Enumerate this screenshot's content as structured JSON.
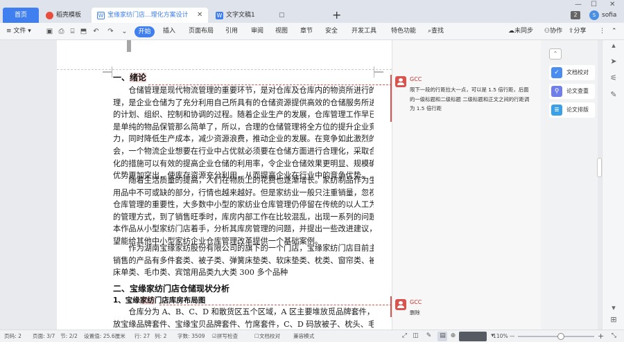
{
  "tabs": {
    "home": "首页",
    "template": "稻壳模板",
    "doc": "宝缘家纺门店...理化方案设计",
    "doc2": "文字文稿1",
    "add": "+"
  },
  "window": {
    "min": "—",
    "max": "☐",
    "close": "✕",
    "badge": "2",
    "user": "sofia"
  },
  "ribbon": {
    "file": "≡ 文件 ▾",
    "start": "开始",
    "tabs": [
      "插入",
      "页面布局",
      "引用",
      "审阅",
      "视图",
      "章节",
      "安全",
      "开发工具",
      "特色功能"
    ],
    "search": "查找",
    "sync": "未同步",
    "collab": "协作",
    "share": "分享"
  },
  "document": {
    "h1_num": "一、",
    "h1_text": "绪论",
    "p1": [
      "　　仓储管理是现代物流管理的重要环节，是对仓库及仓库内的物资所进行的管",
      "理，是企业仓储为了充分利用自己所具有的仓储资源提供高效的仓储服务所进行",
      "的计划、组织、控制和协调的过程。随着企业生产的发展，仓库管理工作早已不",
      "是单纯的物品保管那么简单了，所以，合理的仓储管理将全方位的提升企业竞争",
      "力，同时降低生产成本，减少资源浪费，推动企业的发展。在竞争如此激烈的社",
      "会，一个物流企业想要在行业中占优就必须要在仓储方面进行合理化，采取合理",
      "化的措施可以有效的提高企业仓储的利用率，令企业仓储效果更明显、规模确定、",
      "优势更加突出，使库存资源充分利用，从而提高企业在行业中的竞争优势。"
    ],
    "p2": [
      "　　随着生活质量的提高，人们在物质上的花费也逐渐增长。家纺制品作为生活",
      "用品中不可或缺的部分，行情也越来越好。但是家纺业一般只注重销量，忽视了",
      "仓库管理的重要性，大多数中小型的家纺业仓库管理仍停留在传统的以人工为主",
      "的管理方式，到了销售旺季时，库房内部工作在比较混乱，出现一系列的问题。",
      "本作品从小型家纺门店着手，分析其库房管理的问题，并提出一些改进建议，希",
      "望能给其他中小型家纺企业仓库管理改革提供一个基础案例。"
    ],
    "p3": [
      "　　作为湖南宝缘家纺股份有限公司的旗下的一个门店，宝缘家纺门店目前主要",
      "销售的产品有多件套类、被子类、弹簧床垫类、软床垫类、枕类、窗帘类、被套",
      "床单类、毛巾类、宾馆用品类九大类 300 多个品种"
    ],
    "h2_text": "二、宝缘家纺门店仓储现状分析",
    "h3_pre": "1、宝缘",
    "h3_hl": "家纺",
    "h3_post": "门店库房布局图",
    "p4": [
      "　　仓库分为 A、B、C、D 和散货区五个区域，A 区主要堆放觅品牌套件，B 区码",
      "放宝缘品牌套件、宝缘宝贝品牌套件、竹席套件，C、D 码放被子、枕头、毛毯。"
    ]
  },
  "comments": [
    {
      "author": "GCC",
      "text": "限下一段的行距拉大一点，可以是 1.5 倍行距，后面的一级标题和二级标题 二级标题和正文之间的行距调为 1.5 倍行距"
    },
    {
      "author": "GCC",
      "text": "删除"
    }
  ],
  "right_panel": {
    "collapse": "⌃",
    "buttons": [
      {
        "label": "文档校对",
        "color": "#4a8df0"
      },
      {
        "label": "论文查重",
        "color": "#6f7ee8"
      },
      {
        "label": "论文排版",
        "color": "#3aa0e8"
      }
    ]
  },
  "status": {
    "page_num": "页码: 2",
    "page": "页面: 3/7",
    "section": "节: 2/2",
    "setting": "设置值: 25.6厘米",
    "row": "行: 27",
    "col": "列: 2",
    "words": "字数: 3509",
    "spell": "拼写检查",
    "proof": "文档校对",
    "compat": "兼容模式",
    "zoom": "110%",
    "minus": "—",
    "plus": "+"
  }
}
